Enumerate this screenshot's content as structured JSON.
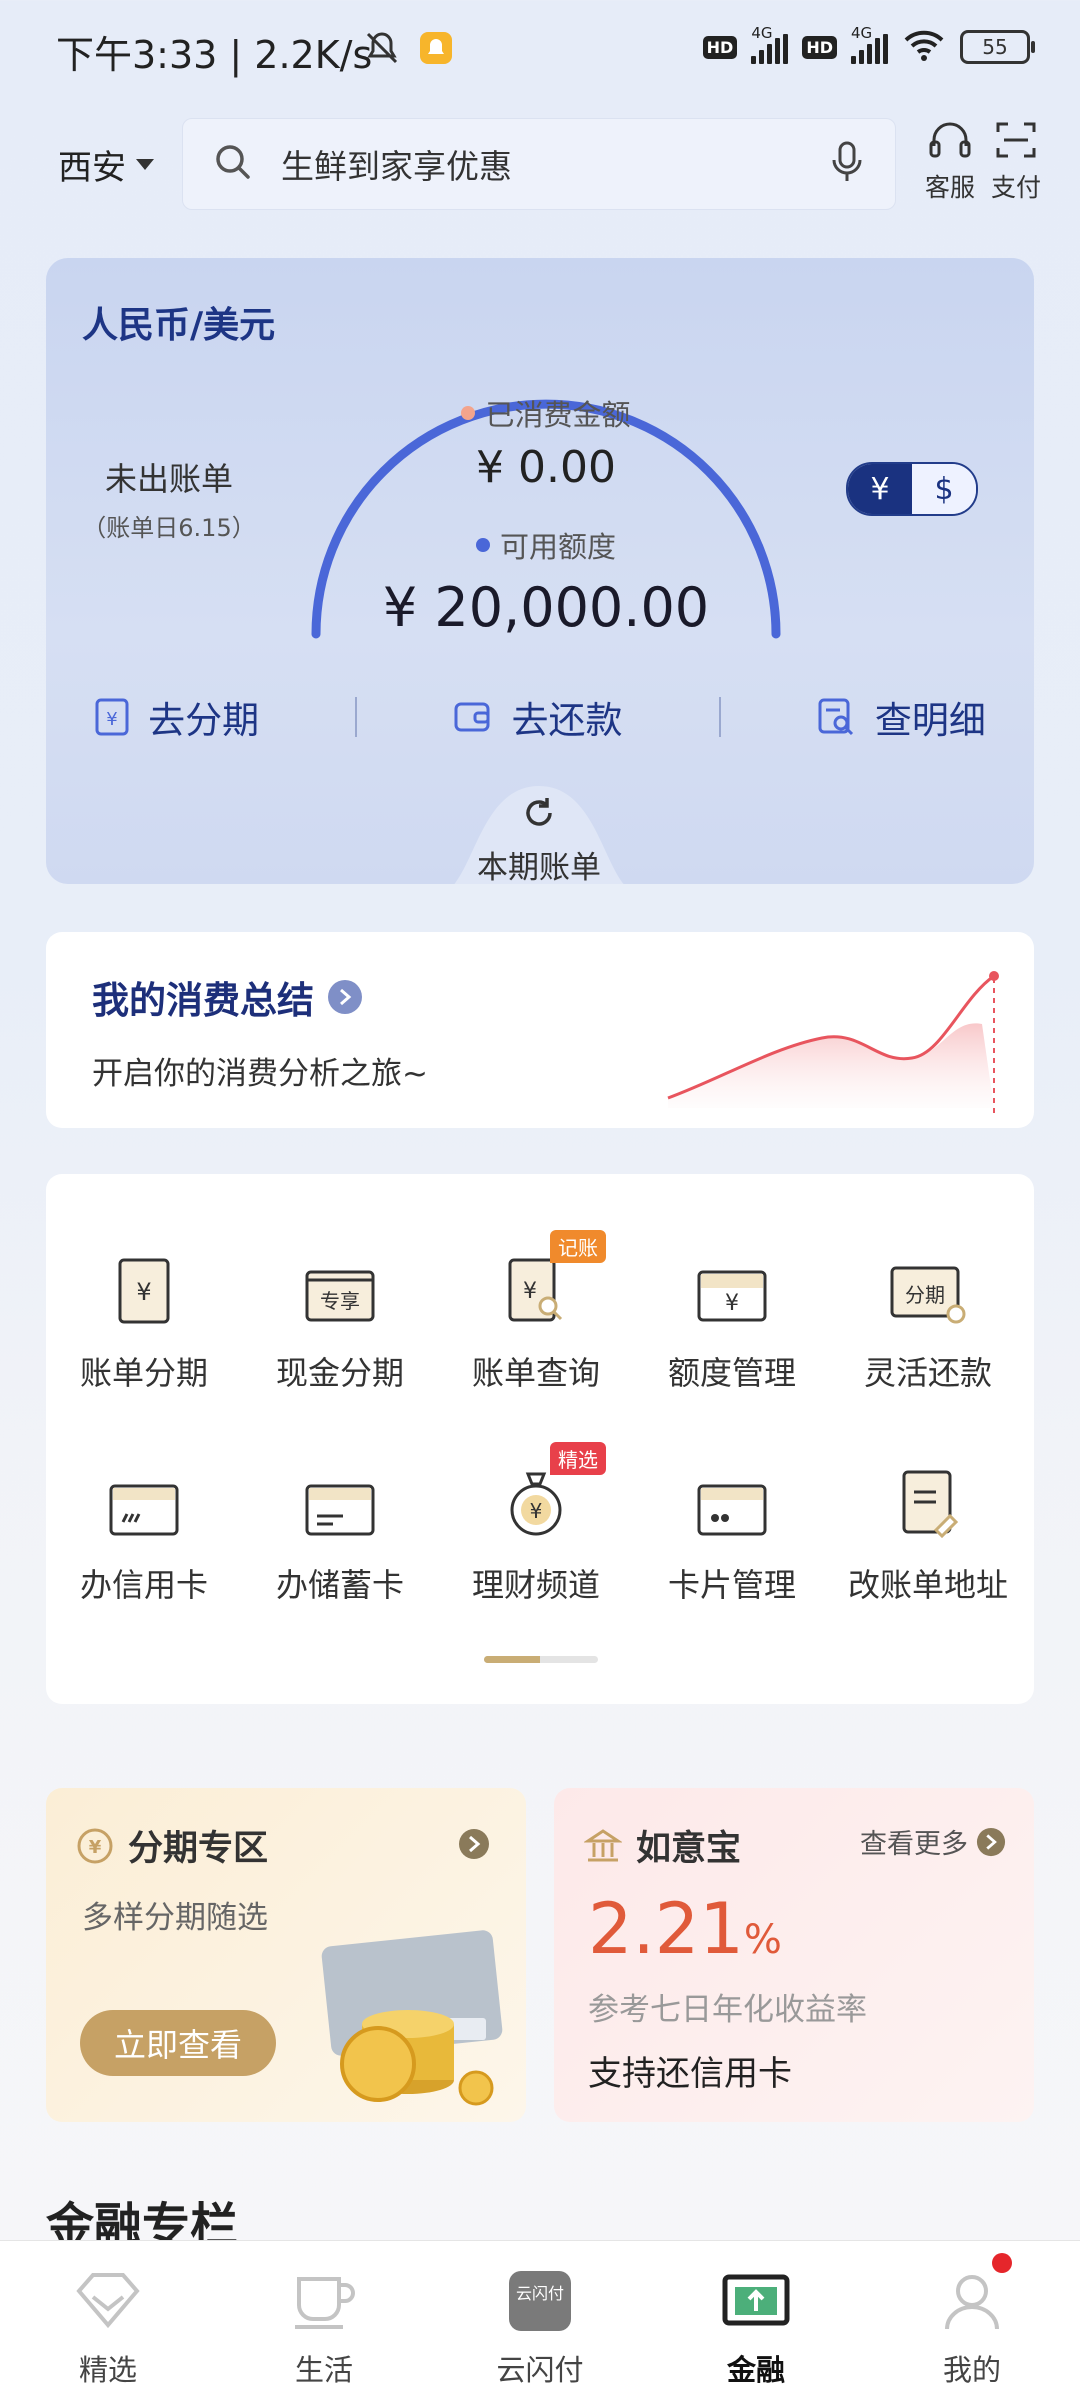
{
  "status_bar": {
    "time_speed": "下午3:33 | 2.2K/s",
    "net1": "4G",
    "net2": "4G",
    "battery": "55"
  },
  "header": {
    "city": "西安",
    "search_placeholder": "生鲜到家享优惠",
    "service_label": "客服",
    "pay_label": "支付"
  },
  "credit_card": {
    "currency_title": "人民币/美元",
    "unbilled_label": "未出账单",
    "bill_day": "（账单日6.15）",
    "spent_label": "已消费金额",
    "spent_value": "¥ 0.00",
    "available_label": "可用额度",
    "available_value": "¥ 20,000.00",
    "toggle_cny": "¥",
    "toggle_usd": "$",
    "actions": [
      "去分期",
      "去还款",
      "查明细"
    ],
    "current_bill": "本期账单",
    "accent": "#4a67d8",
    "spent_dot": "#f3a48c"
  },
  "summary": {
    "title": "我的消费总结",
    "subtitle": "开启你的消费分析之旅~"
  },
  "grid": {
    "row1": [
      {
        "label": "账单分期",
        "icon": "bill-installment-icon"
      },
      {
        "label": "现金分期",
        "icon": "cash-installment-icon"
      },
      {
        "label": "账单查询",
        "icon": "bill-query-icon",
        "tag": "记账"
      },
      {
        "label": "额度管理",
        "icon": "limit-icon"
      },
      {
        "label": "灵活还款",
        "icon": "flexible-repay-icon"
      }
    ],
    "row2": [
      {
        "label": "办信用卡",
        "icon": "credit-card-icon"
      },
      {
        "label": "办储蓄卡",
        "icon": "debit-card-icon"
      },
      {
        "label": "理财频道",
        "icon": "wealth-icon",
        "tag": "精选"
      },
      {
        "label": "卡片管理",
        "icon": "card-manage-icon"
      },
      {
        "label": "改账单地址",
        "icon": "address-edit-icon"
      }
    ],
    "icon_text": {
      "yen": "¥",
      "exclusive": "专享",
      "installment": "分期"
    }
  },
  "promo_installment": {
    "title": "分期专区",
    "subtitle": "多样分期随选",
    "cta": "立即查看"
  },
  "promo_ruyibao": {
    "title": "如意宝",
    "more": "查看更多",
    "rate": "2.21",
    "rate_unit": "%",
    "rate_desc": "参考七日年化收益率",
    "feature": "支持还信用卡"
  },
  "section_title": "金融专栏",
  "bottom_nav": [
    {
      "label": "精选"
    },
    {
      "label": "生活"
    },
    {
      "label": "云闪付",
      "logo_text": "云闪付"
    },
    {
      "label": "金融",
      "active": true
    },
    {
      "label": "我的"
    }
  ]
}
